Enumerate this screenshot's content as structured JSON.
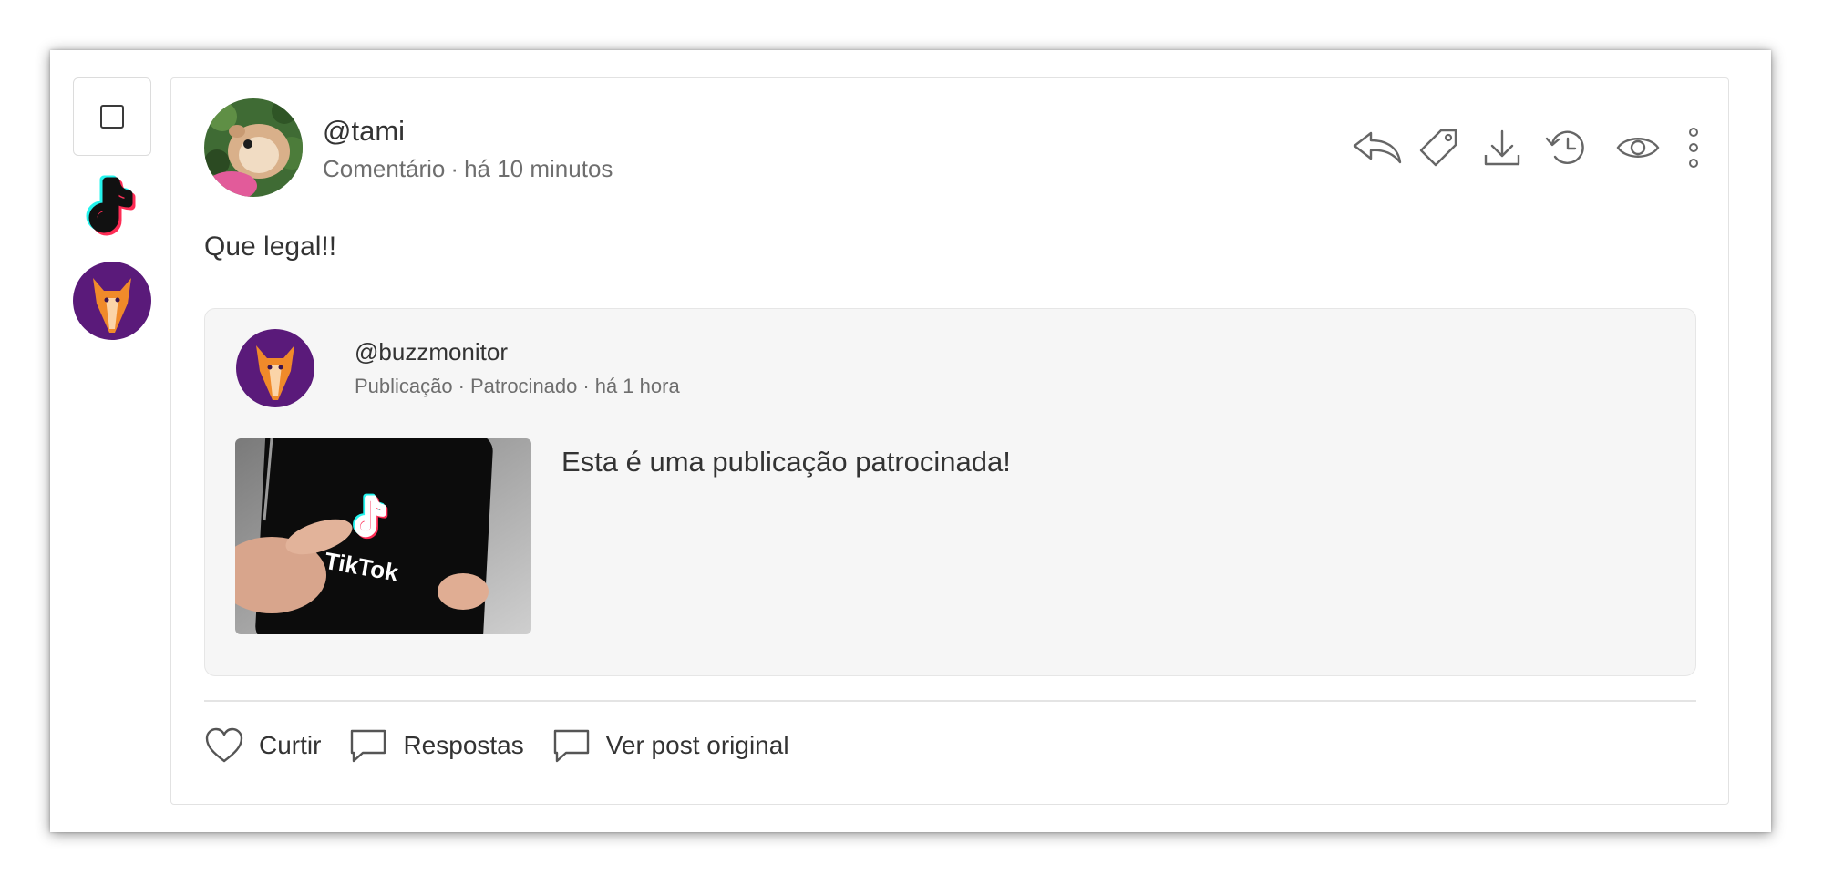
{
  "left_rail": {
    "select_checkbox": "unchecked",
    "network_icon": "tiktok-icon",
    "brand_avatar": "fox-avatar"
  },
  "post": {
    "author": "@tami",
    "type": "Comentário",
    "time": "há 10 minutos",
    "text": "Que legal!!",
    "actions": [
      "reply-icon",
      "tag-icon",
      "download-icon",
      "history-icon",
      "eye-icon",
      "more-vertical-icon"
    ]
  },
  "embedded_post": {
    "author": "@buzzmonitor",
    "type": "Publicação",
    "sponsored": "Patrocinado",
    "time": "há 1 hora",
    "text": "Esta é uma publicação patrocinada!",
    "image_label": "TikTok"
  },
  "footer": {
    "like": "Curtir",
    "replies": "Respostas",
    "view_original": "Ver post original"
  },
  "colors": {
    "brand_purple": "#5a1a7a",
    "fox_orange": "#f08a2a",
    "tiktok_cyan": "#25f4ee",
    "tiktok_pink": "#fe2c55"
  }
}
